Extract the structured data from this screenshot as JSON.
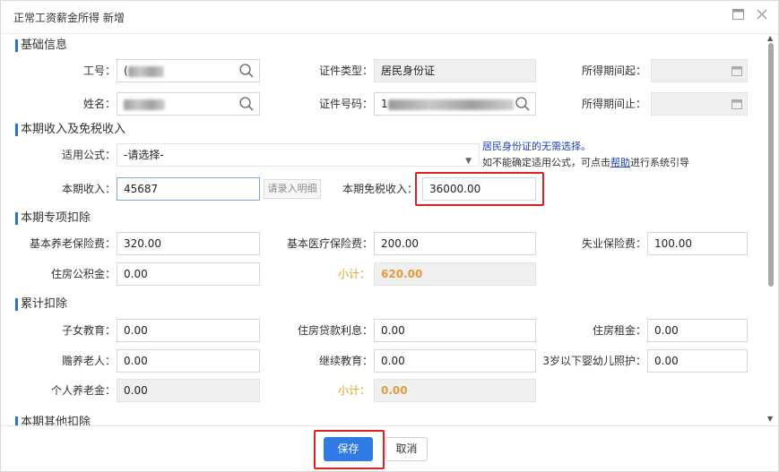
{
  "dialog": {
    "title": "正常工资薪金所得 新增",
    "max_icon": "window-maximize-icon",
    "close_icon": "close-icon"
  },
  "basic": {
    "section_title": "基础信息",
    "emp_no_label": "工号：",
    "emp_no_prefix": "(",
    "name_label": "姓名：",
    "id_type_label": "证件类型：",
    "id_type_value": "居民身份证",
    "id_no_label": "证件号码：",
    "id_no_prefix": "1",
    "period_start_label": "所得期间起：",
    "period_end_label": "所得期间止："
  },
  "income": {
    "section_title": "本期收入及免税收入",
    "formula_label": "适用公式：",
    "formula_value": "-请选择-",
    "hint_line1": "居民身份证的无需选择。",
    "hint_line2_prefix": "如不能确定适用公式，可点击",
    "hint_help_link": "帮助",
    "hint_line2_suffix": "进行系统引导",
    "current_income_label": "本期收入：",
    "current_income_value": "45687",
    "detail_button": "请录入明细",
    "tax_free_label": "本期免税收入：",
    "tax_free_value": "36000.00"
  },
  "special": {
    "section_title": "本期专项扣除",
    "pension_label": "基本养老保险费：",
    "pension_value": "320.00",
    "medical_label": "基本医疗保险费：",
    "medical_value": "200.00",
    "unemployment_label": "失业保险费：",
    "unemployment_value": "100.00",
    "housing_fund_label": "住房公积金：",
    "housing_fund_value": "0.00",
    "subtotal_label": "小计：",
    "subtotal_value": "620.00"
  },
  "cumulative": {
    "section_title": "累计扣除",
    "children_edu_label": "子女教育：",
    "children_edu_value": "0.00",
    "housing_loan_label": "住房贷款利息：",
    "housing_loan_value": "0.00",
    "housing_rent_label": "住房租金：",
    "housing_rent_value": "0.00",
    "elderly_label": "赡养老人：",
    "elderly_value": "0.00",
    "continuing_edu_label": "继续教育：",
    "continuing_edu_value": "0.00",
    "infant_care_label": "3岁以下婴幼儿照护：",
    "infant_care_value": "0.00",
    "personal_pension_label": "个人养老金：",
    "personal_pension_value": "0.00",
    "subtotal_label": "小计：",
    "subtotal_value": "0.00"
  },
  "next_section_partial": "本期其他扣除",
  "footer": {
    "save_label": "保存",
    "cancel_label": "取消"
  },
  "colors": {
    "accent": "#2f7ae5",
    "section_bar": "#2f6fd6",
    "highlight_box": "#e02020",
    "subtotal": "#e69a3a"
  }
}
